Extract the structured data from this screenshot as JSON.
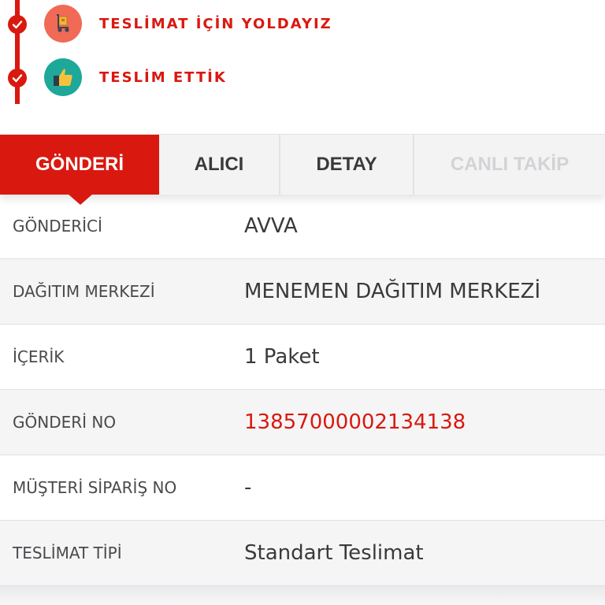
{
  "timeline": {
    "steps": [
      {
        "label": "TESLİMAT İÇİN YOLDAYIZ",
        "icon": "hand-truck-icon",
        "status": "done"
      },
      {
        "label": "TESLİM ETTİK",
        "icon": "thumbs-up-icon",
        "status": "done"
      }
    ]
  },
  "tabs": [
    {
      "label": "GÖNDERİ",
      "state": "active"
    },
    {
      "label": "ALICI",
      "state": "normal"
    },
    {
      "label": "DETAY",
      "state": "normal"
    },
    {
      "label": "CANLI TAKİP",
      "state": "disabled"
    }
  ],
  "details": [
    {
      "label": "GÖNDERİCİ",
      "value": "AVVA"
    },
    {
      "label": "DAĞITIM MERKEZİ",
      "value": "MENEMEN DAĞITIM MERKEZİ"
    },
    {
      "label": "İÇERİK",
      "value": "1 Paket"
    },
    {
      "label": "GÖNDERİ NO",
      "value": "13857000002134138"
    },
    {
      "label": "MÜŞTERİ SİPARİŞ NO",
      "value": "-"
    },
    {
      "label": "TESLİMAT TİPİ",
      "value": "Standart Teslimat"
    }
  ],
  "colors": {
    "accent": "#d9190f",
    "truck_icon_bg": "#f06a55",
    "thumb_icon_bg": "#1ea89a"
  }
}
